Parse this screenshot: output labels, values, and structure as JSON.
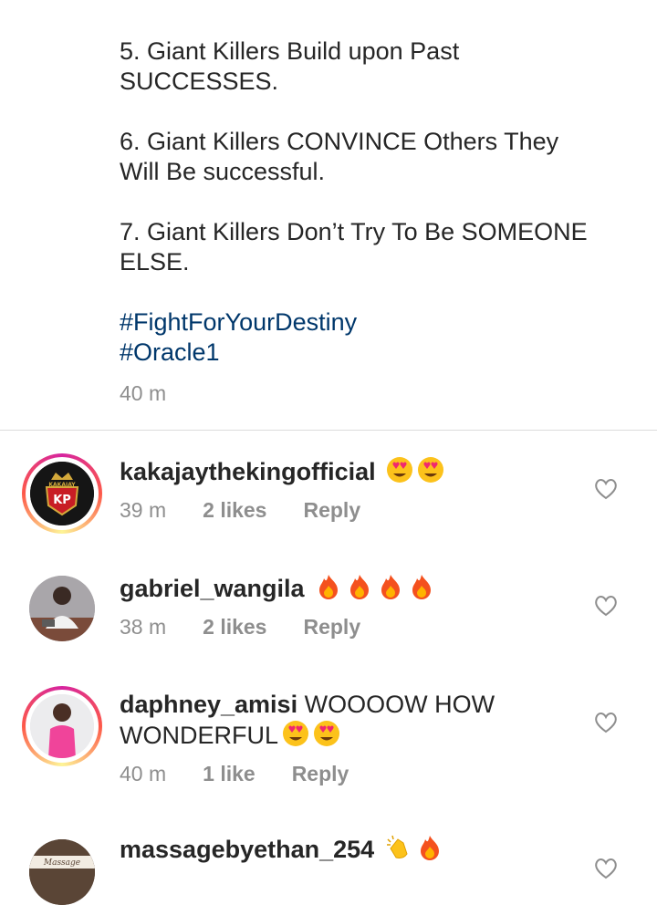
{
  "caption": {
    "lines": [
      "5. Giant Killers Build upon Past",
      "SUCCESSES.",
      "6. Giant Killers CONVINCE Others They",
      "Will Be successful.",
      "7. Giant Killers Don’t Try To Be SOMEONE",
      "ELSE."
    ],
    "hashtags": [
      "#FightForYourDestiny",
      "#Oracle1"
    ],
    "time": "40 m"
  },
  "comments": [
    {
      "user": "kakajaythekingofficial",
      "text": "",
      "emoji": [
        "heart-eyes",
        "heart-eyes"
      ],
      "time": "39 m",
      "likes": "2 likes",
      "reply": "Reply",
      "avatar_logo": "KP",
      "avatar_text": "KAKAJAY"
    },
    {
      "user": "gabriel_wangila",
      "text": "",
      "emoji": [
        "fire",
        "fire",
        "fire",
        "fire"
      ],
      "time": "38 m",
      "likes": "2 likes",
      "reply": "Reply"
    },
    {
      "user": "daphney_amisi",
      "text_line1": "WOOOOW HOW",
      "text_line2": "WONDERFUL",
      "emoji": [
        "heart-eyes",
        "heart-eyes"
      ],
      "time": "40 m",
      "likes": "1 like",
      "reply": "Reply"
    },
    {
      "user": "massagebyethan_254",
      "emoji": [
        "clapping",
        "fire"
      ],
      "avatar_text": "Massage"
    }
  ],
  "colors": {
    "text": "#262626",
    "secondary": "#8e8e8e",
    "hashtag": "#00376b",
    "divider": "#dbdbdb"
  }
}
